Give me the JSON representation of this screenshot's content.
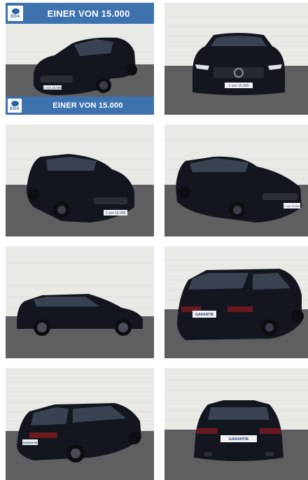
{
  "gallery": {
    "banner_text": "EINER VON 15.000",
    "logo_text": "EGA",
    "plate_text": "1 von 15.000",
    "rear_plate_text": "GARANTIE",
    "photos": [
      {
        "id": "front-left",
        "label": "Front-left view"
      },
      {
        "id": "front",
        "label": "Front view"
      },
      {
        "id": "front-left-2",
        "label": "Front-left view"
      },
      {
        "id": "front-right",
        "label": "Front-right view"
      },
      {
        "id": "side-left",
        "label": "Left side view"
      },
      {
        "id": "rear-right",
        "label": "Rear-right view"
      },
      {
        "id": "rear-left",
        "label": "Rear-left view"
      },
      {
        "id": "rear",
        "label": "Rear view"
      }
    ]
  },
  "colors": {
    "banner": "#3d72ae",
    "car": "#14161f",
    "wall": "#e9e9e6",
    "floor": "#5f5f61"
  }
}
